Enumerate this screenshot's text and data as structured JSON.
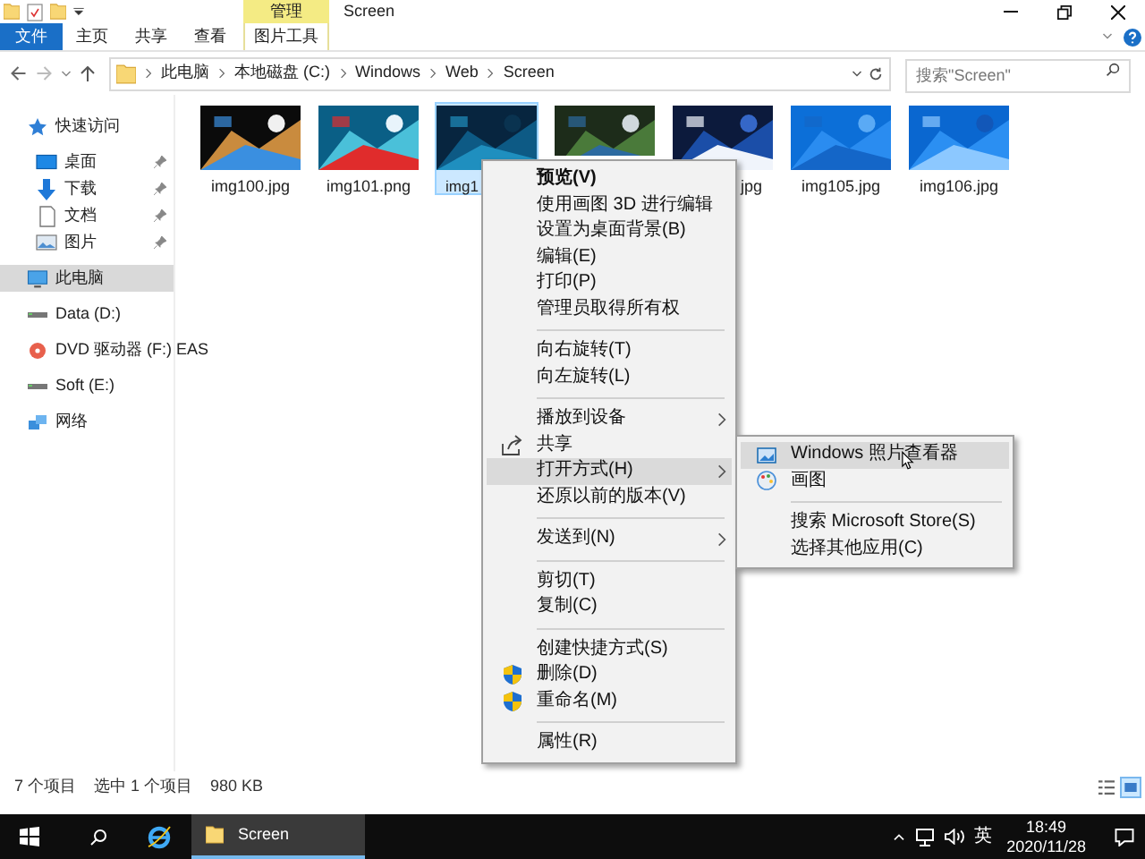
{
  "window": {
    "title": "Screen",
    "context_group": "管理"
  },
  "ribbon_tabs": [
    {
      "label": "文件",
      "kind": "file"
    },
    {
      "label": "主页",
      "kind": "normal"
    },
    {
      "label": "共享",
      "kind": "normal"
    },
    {
      "label": "查看",
      "kind": "normal"
    },
    {
      "label": "图片工具",
      "kind": "context"
    }
  ],
  "address": {
    "path": [
      "此电脑",
      "本地磁盘 (C:)",
      "Windows",
      "Web",
      "Screen"
    ],
    "search_placeholder": "搜索\"Screen\""
  },
  "sidebar": [
    {
      "label": "快速访问",
      "kind": "star",
      "selected": false,
      "children": [
        {
          "label": "桌面",
          "kind": "desktop",
          "pinned": true
        },
        {
          "label": "下载",
          "kind": "download",
          "pinned": true
        },
        {
          "label": "文档",
          "kind": "document",
          "pinned": true
        },
        {
          "label": "图片",
          "kind": "pictures",
          "pinned": true
        }
      ]
    },
    {
      "label": "此电脑",
      "kind": "pc",
      "selected": true
    },
    {
      "label": "Data (D:)",
      "kind": "drive",
      "selected": false
    },
    {
      "label": "DVD 驱动器 (F:) EAS",
      "kind": "dvd",
      "selected": false
    },
    {
      "label": "Soft (E:)",
      "kind": "drive",
      "selected": false
    },
    {
      "label": "网络",
      "kind": "network",
      "selected": false
    }
  ],
  "files": [
    {
      "name": "img100.jpg",
      "selected": false,
      "kind": "full"
    },
    {
      "name": "img101.png",
      "selected": false,
      "kind": "full"
    },
    {
      "name": "img1",
      "selected": true,
      "kind": "head"
    },
    {
      "selected": false,
      "kind": "hidden"
    },
    {
      "name": "jpg",
      "selected": false,
      "kind": "tail"
    },
    {
      "name": "img105.jpg",
      "selected": false,
      "kind": "full"
    },
    {
      "name": "img106.jpg",
      "selected": false,
      "kind": "full"
    }
  ],
  "context_menu": [
    {
      "kind": "item",
      "label": "预览(V)",
      "bold": true
    },
    {
      "kind": "item",
      "label": "使用画图 3D 进行编辑"
    },
    {
      "kind": "item",
      "label": "设置为桌面背景(B)"
    },
    {
      "kind": "item",
      "label": "编辑(E)"
    },
    {
      "kind": "item",
      "label": "打印(P)"
    },
    {
      "kind": "item",
      "label": "管理员取得所有权"
    },
    {
      "kind": "separator"
    },
    {
      "kind": "item",
      "label": "向右旋转(T)"
    },
    {
      "kind": "item",
      "label": "向左旋转(L)"
    },
    {
      "kind": "separator"
    },
    {
      "kind": "item",
      "label": "播放到设备",
      "submenu": true
    },
    {
      "kind": "share",
      "label": "共享"
    },
    {
      "kind": "item",
      "label": "打开方式(H)",
      "submenu": true,
      "highlighted": true
    },
    {
      "kind": "item",
      "label": "还原以前的版本(V)"
    },
    {
      "kind": "separator"
    },
    {
      "kind": "item",
      "label": "发送到(N)",
      "submenu": true
    },
    {
      "kind": "separator"
    },
    {
      "kind": "item",
      "label": "剪切(T)"
    },
    {
      "kind": "item",
      "label": "复制(C)"
    },
    {
      "kind": "separator"
    },
    {
      "kind": "item",
      "label": "创建快捷方式(S)"
    },
    {
      "kind": "shield",
      "label": "删除(D)"
    },
    {
      "kind": "shield",
      "label": "重命名(M)"
    },
    {
      "kind": "separator"
    },
    {
      "kind": "item",
      "label": "属性(R)"
    }
  ],
  "open_with_menu": [
    {
      "kind": "viewer",
      "label": "Windows 照片查看器",
      "highlighted": true
    },
    {
      "kind": "paint",
      "label": "画图"
    },
    {
      "kind": "separator"
    },
    {
      "kind": "item",
      "label": "搜索 Microsoft Store(S)"
    },
    {
      "kind": "item",
      "label": "选择其他应用(C)"
    }
  ],
  "status_bar": {
    "count": "7 个项目",
    "selection": "选中 1 个项目",
    "size": "980 KB"
  },
  "taskbar": {
    "app": "Screen",
    "ime": "英",
    "time": "18:49",
    "date": "2020/11/28"
  }
}
